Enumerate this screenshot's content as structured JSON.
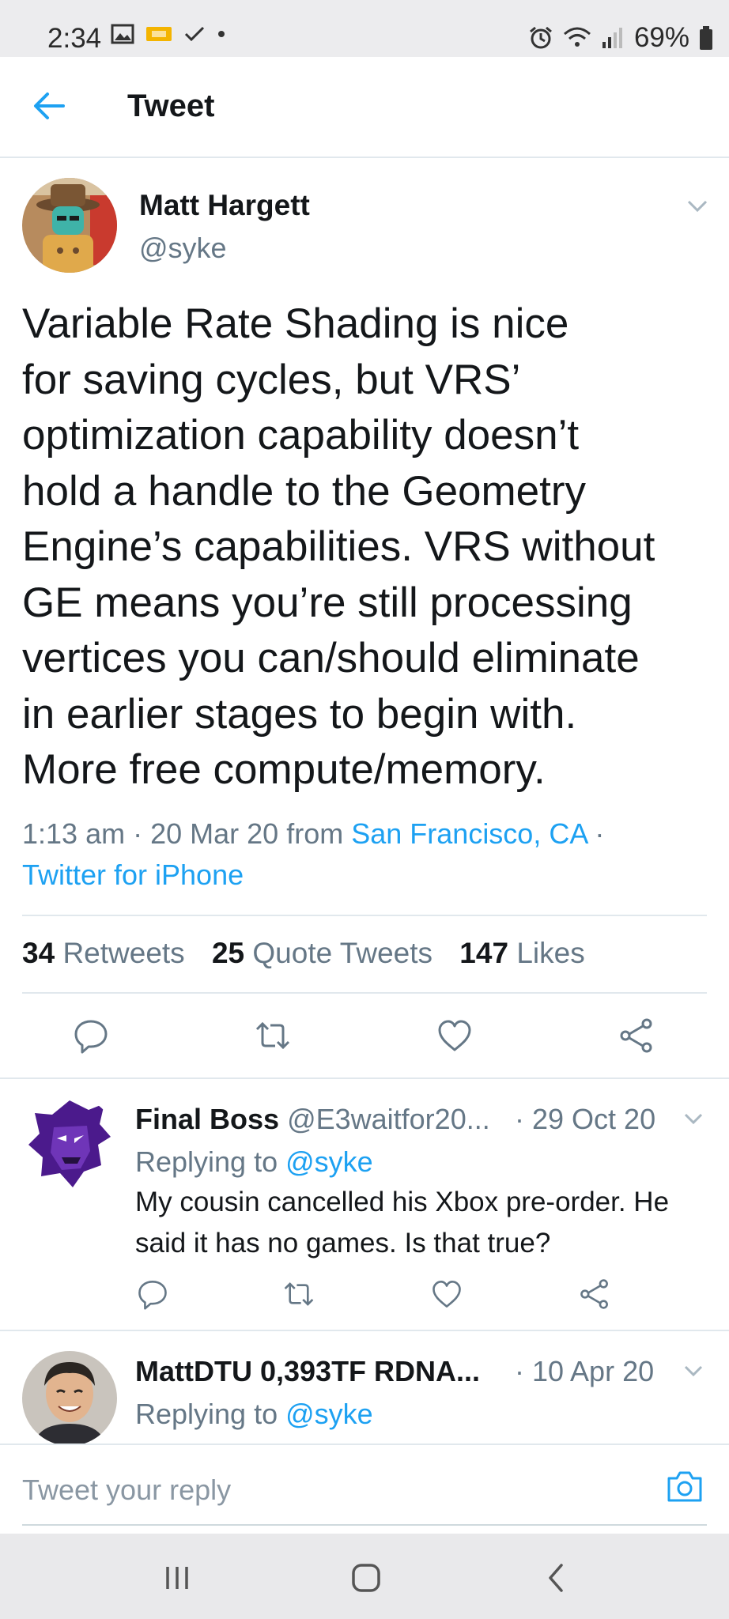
{
  "status_bar": {
    "time": "2:34",
    "battery": "69%"
  },
  "header": {
    "title": "Tweet"
  },
  "tweet": {
    "author_name": "Matt Hargett",
    "author_handle": "@syke",
    "text": "Variable Rate Shading is nice\nfor saving cycles, but VRS’\noptimization capability doesn’t\nhold a handle to the Geometry\nEngine’s capabilities. VRS without\nGE means you’re still processing\nvertices you can/should eliminate\nin earlier stages to begin with.\nMore free compute/memory.",
    "time": "1:13 am",
    "dot1": "·",
    "date": "20 Mar 20",
    "from_label": "from",
    "location": "San Francisco, CA",
    "dot2": "·",
    "client": "Twitter for iPhone",
    "stats": {
      "retweets_count": "34",
      "retweets_label": "Retweets",
      "quotes_count": "25",
      "quotes_label": "Quote Tweets",
      "likes_count": "147",
      "likes_label": "Likes"
    }
  },
  "replies": [
    {
      "name": "Final Boss",
      "handle": "@E3waitfor20...",
      "date": "· 29 Oct 20",
      "replying_label": "Replying to",
      "replying_to": "@syke",
      "text": "My cousin cancelled his Xbox pre-order. He said it has no games. Is that true?"
    },
    {
      "name": "MattDTU 0,393TF RDNA...",
      "date": "· 10 Apr 20",
      "replying_label": "Replying to",
      "replying_to": "@syke"
    }
  ],
  "reply_bar": {
    "placeholder": "Tweet your reply"
  },
  "colors": {
    "accent": "#1da1f2",
    "text": "#14171a",
    "muted": "#657786",
    "divider": "#e1e8ed"
  },
  "icons": [
    "back-arrow-icon",
    "chevron-down-icon",
    "reply-icon",
    "retweet-icon",
    "like-icon",
    "share-icon",
    "camera-icon",
    "recent-apps-icon",
    "home-icon",
    "back-icon"
  ]
}
